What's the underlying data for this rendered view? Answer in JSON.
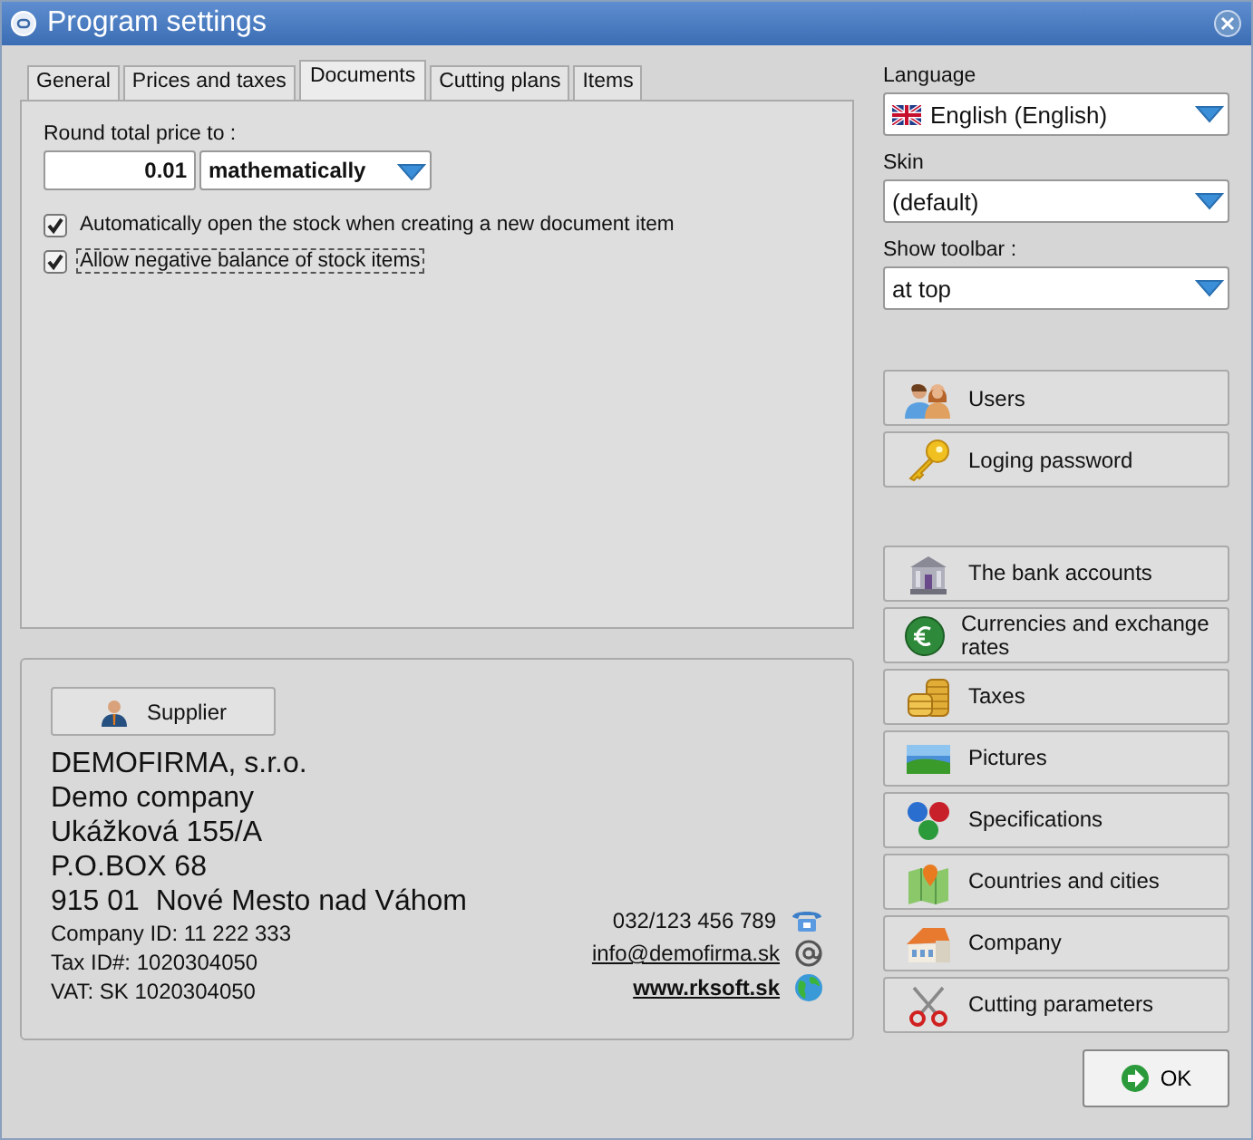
{
  "window": {
    "title": "Program settings"
  },
  "tabs": [
    {
      "label": "General",
      "selected": false
    },
    {
      "label": "Prices and taxes",
      "selected": false
    },
    {
      "label": "Documents",
      "selected": true
    },
    {
      "label": "Cutting plans",
      "selected": false
    },
    {
      "label": "Items",
      "selected": false
    }
  ],
  "documents": {
    "round_label": "Round total price to :",
    "round_value": "0.01",
    "round_mode": "mathematically",
    "options": [
      {
        "label": "Automatically open the stock when creating a new document item",
        "checked": true,
        "focused": false
      },
      {
        "label": "Allow negative balance of stock items",
        "checked": true,
        "focused": true
      }
    ]
  },
  "settings": [
    {
      "label": "Language",
      "value": "English (English)",
      "kind": "flag"
    },
    {
      "label": "Skin",
      "value": "(default)",
      "kind": "plain"
    },
    {
      "label": "Show toolbar :",
      "value": "at top",
      "kind": "plain"
    }
  ],
  "buttons_top": [
    {
      "label": "Users"
    },
    {
      "label": "Loging password"
    }
  ],
  "buttons_bottom": [
    {
      "label": "The bank accounts"
    },
    {
      "label": "Currencies and exchange rates"
    },
    {
      "label": "Taxes"
    },
    {
      "label": "Pictures"
    },
    {
      "label": "Specifications"
    },
    {
      "label": "Countries and cities"
    },
    {
      "label": "Company"
    },
    {
      "label": "Cutting parameters"
    }
  ],
  "supplier": {
    "button": "Supplier",
    "lines": [
      "DEMOFIRMA, s.r.o.",
      "Demo company",
      "Ukážková 155/A",
      "P.O.BOX 68",
      "915 01  Nové Mesto nad Váhom"
    ],
    "ids": [
      "Company ID: 11 222 333",
      "Tax ID#: 1020304050",
      "VAT: SK 1020304050"
    ],
    "contacts": [
      {
        "kind": "phone",
        "text": "032/123 456 789"
      },
      {
        "kind": "email",
        "text": "info@demofirma.sk"
      },
      {
        "kind": "web",
        "text": "www.rksoft.sk"
      }
    ]
  },
  "ok_button": "OK"
}
